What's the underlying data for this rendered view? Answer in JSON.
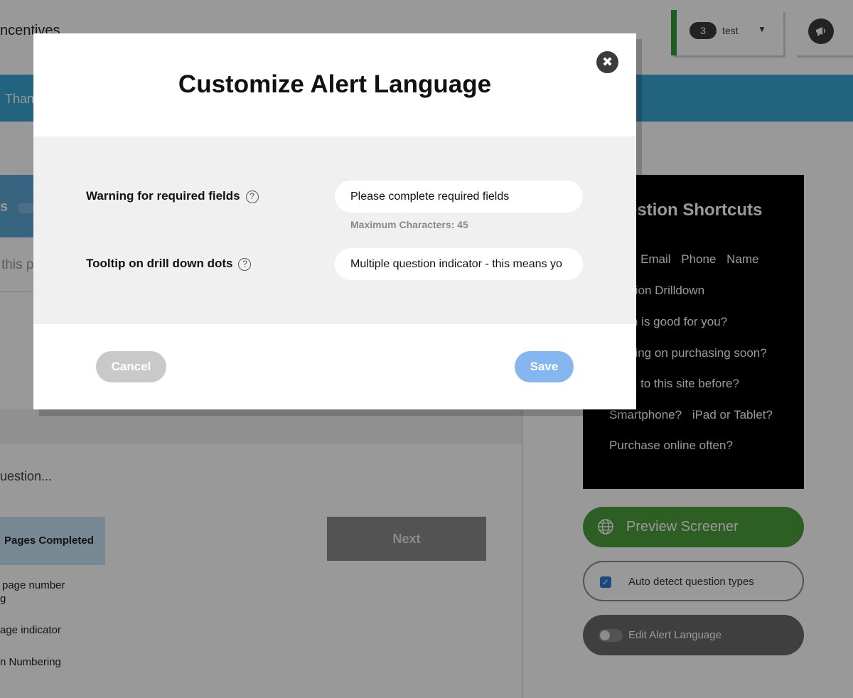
{
  "app": {
    "title": "ncentives",
    "account": {
      "count": "3",
      "name": "test",
      "caret": "▼"
    },
    "banner_text": "Than",
    "left_card_text": "s",
    "page_hint": "this p",
    "question_hint": "uestion...",
    "pages_completed_label": "Pages Completed",
    "next_label": "Next",
    "options": {
      "page_number_line1": "page number",
      "page_number_line2": "g",
      "page_indicator": "age indicator",
      "numbering": "n Numbering"
    }
  },
  "shortcuts": {
    "title": "estion Shortcuts",
    "row_contact": [
      "Email",
      "Phone",
      "Name"
    ],
    "drilldown": "tion Drilldown",
    "good_for_you": "n is good for you?",
    "purchasing_soon": "ning on purchasing soon?",
    "site_before": "to this site before?",
    "devices": [
      "Smartphone?",
      "iPad or Tablet?"
    ],
    "purchase_online": "Purchase online often?"
  },
  "sidebar_actions": {
    "preview_label": "Preview Screener",
    "auto_detect_label": "Auto detect question types",
    "auto_detect_checked": true,
    "edit_alert_label": "Edit Alert Language",
    "edit_alert_on": false
  },
  "modal": {
    "title": "Customize Alert Language",
    "close_glyph": "✖",
    "fields": [
      {
        "label": "Warning for required fields",
        "value": "Please complete required fields",
        "hint": "Maximum Characters: 45"
      },
      {
        "label": "Tooltip on drill down dots",
        "value": "Multiple question indicator - this means yo"
      }
    ],
    "cancel_label": "Cancel",
    "save_label": "Save"
  },
  "colors": {
    "banner": "#3aa7d6",
    "account_accent": "#2f9b3c",
    "preview_button": "#4c9d3b",
    "save_button": "#86b6f0",
    "cancel_button": "#c9c9c9",
    "checkbox": "#2e78d6"
  }
}
